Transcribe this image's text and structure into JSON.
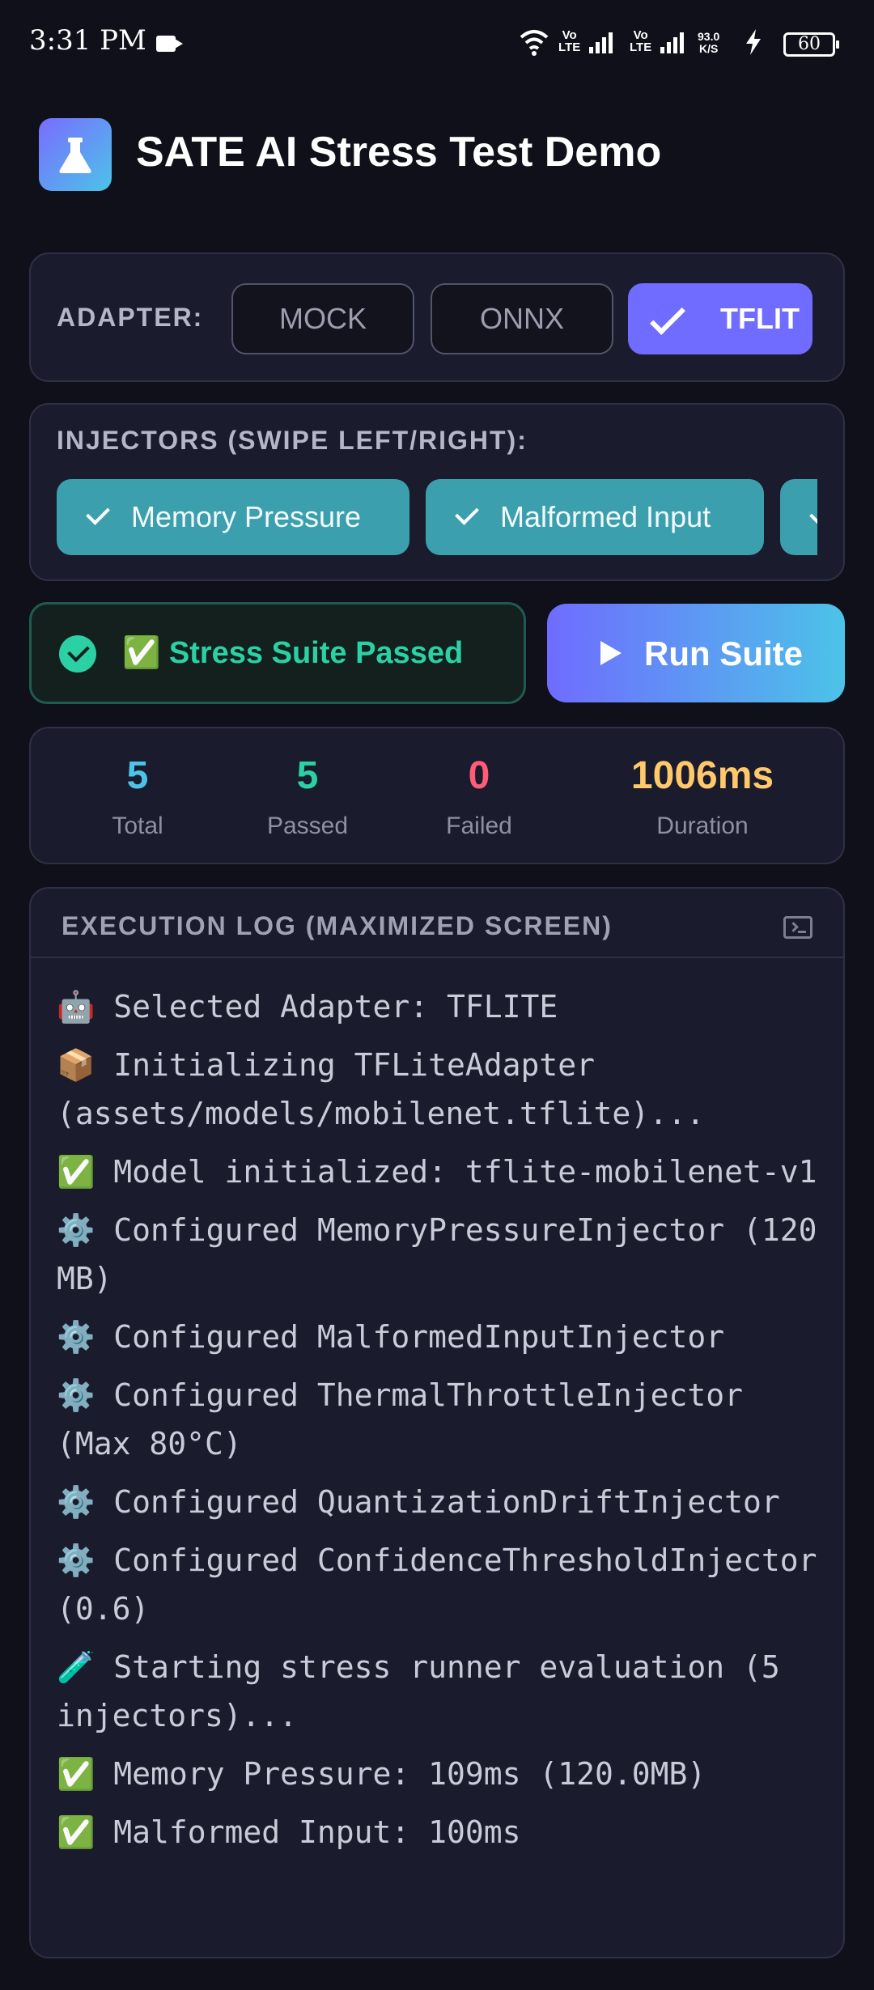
{
  "status_bar": {
    "time": "3:31 PM",
    "net1": "Vo\nLTE",
    "net2": "Vo\nLTE",
    "speed": "93.0\nK/S",
    "battery": "60"
  },
  "header": {
    "title": "SATE AI Stress Test Demo",
    "icon": "flask-icon"
  },
  "adapter": {
    "label": "ADAPTER:",
    "options": [
      {
        "label": "MOCK",
        "selected": false
      },
      {
        "label": "ONNX",
        "selected": false
      },
      {
        "label": "TFLIT",
        "selected": true
      }
    ]
  },
  "injectors": {
    "label": "INJECTORS (SWIPE LEFT/RIGHT):",
    "chips": [
      {
        "label": "Memory Pressure",
        "checked": true
      },
      {
        "label": "Malformed Input",
        "checked": true
      },
      {
        "label": "",
        "checked": true
      }
    ]
  },
  "status": {
    "text": "✅ Stress Suite Passed",
    "color": "#2bd1a4"
  },
  "run_button": {
    "label": "Run Suite"
  },
  "stats": [
    {
      "value": "5",
      "label": "Total",
      "color": "#4cc3e8"
    },
    {
      "value": "5",
      "label": "Passed",
      "color": "#2bd1a4"
    },
    {
      "value": "0",
      "label": "Failed",
      "color": "#ff5c7a"
    },
    {
      "value": "1006ms",
      "label": "Duration",
      "color": "#ffc96b"
    }
  ],
  "log": {
    "title": "EXECUTION LOG (MAXIMIZED SCREEN)",
    "lines": [
      "🤖 Selected Adapter: TFLITE",
      "📦 Initializing TFLiteAdapter (assets/models/mobilenet.tflite)...",
      "✅ Model initialized: tflite-mobilenet-v1",
      "⚙️ Configured MemoryPressureInjector (120 MB)",
      "⚙️ Configured MalformedInputInjector",
      "⚙️ Configured ThermalThrottleInjector (Max 80°C)",
      "⚙️ Configured QuantizationDriftInjector",
      "⚙️ Configured ConfidenceThresholdInjector (0.6)",
      "🧪 Starting stress runner evaluation (5 injectors)...",
      "✅ Memory Pressure: 109ms (120.0MB)",
      "✅ Malformed Input: 100ms"
    ]
  }
}
